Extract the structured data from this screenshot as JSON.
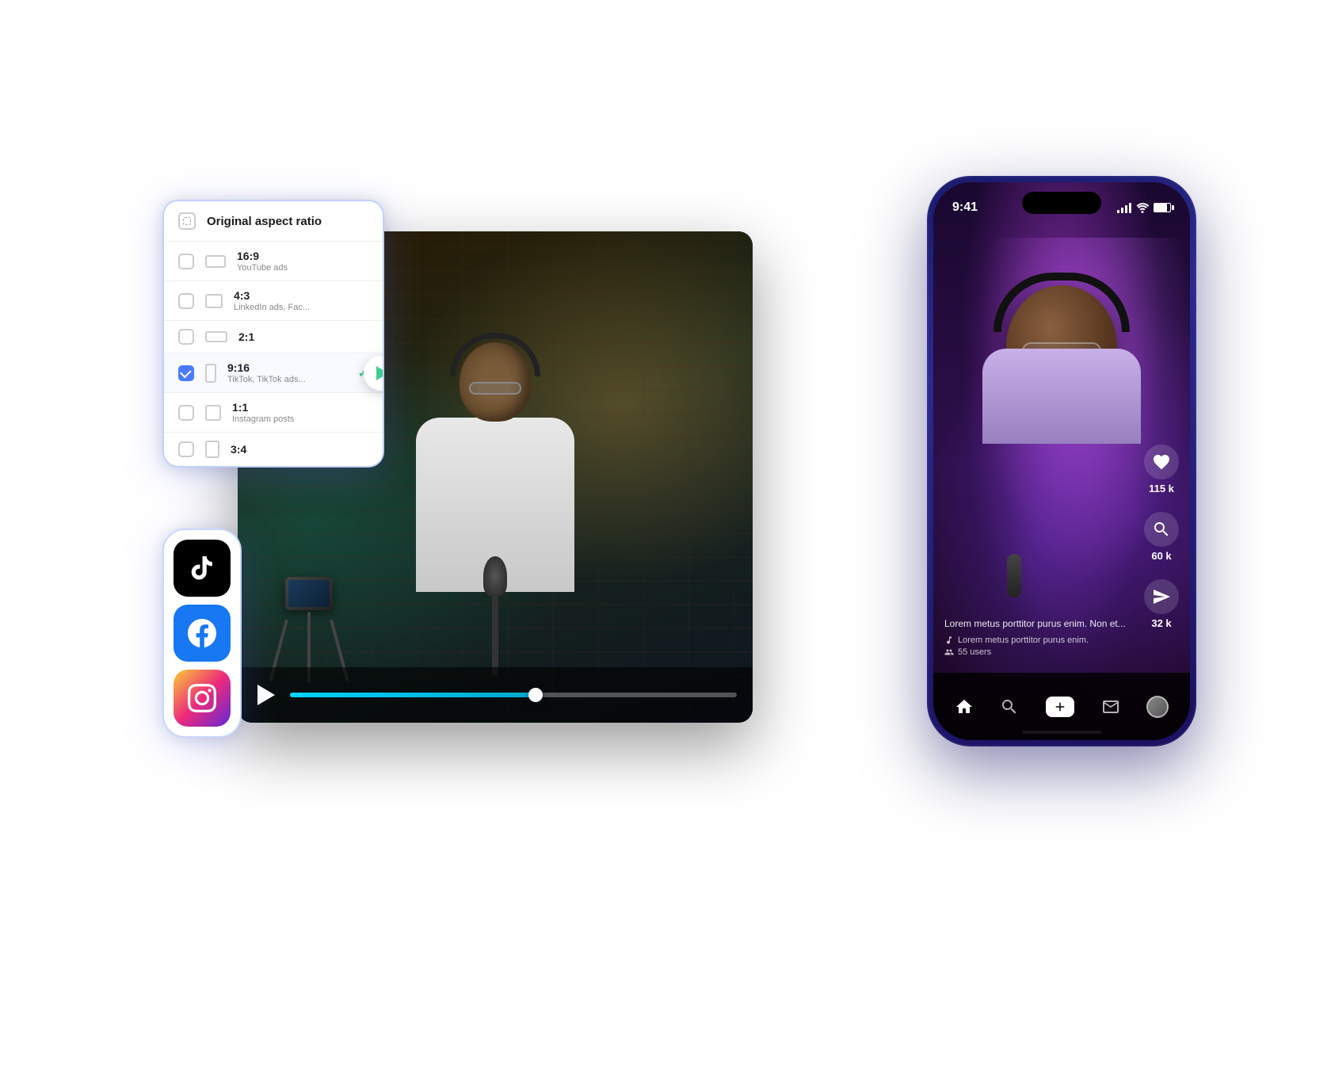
{
  "scene": {
    "background": "#ffffff"
  },
  "aspect_panel": {
    "title": "Original aspect ratio",
    "items": [
      {
        "ratio": "16:9",
        "sub": "YouTube ads",
        "selected": false
      },
      {
        "ratio": "4:3",
        "sub": "LinkedIn ads, Fac...",
        "selected": false
      },
      {
        "ratio": "2:1",
        "sub": "",
        "selected": false
      },
      {
        "ratio": "9:16",
        "sub": "TikTok, TikTok ads...",
        "selected": true,
        "active": true
      },
      {
        "ratio": "1:1",
        "sub": "Instagram posts",
        "selected": false
      },
      {
        "ratio": "3:4",
        "sub": "",
        "selected": false
      }
    ]
  },
  "video_player": {
    "playing": false,
    "progress_percent": 55
  },
  "social_icons": [
    {
      "name": "TikTok",
      "type": "tiktok"
    },
    {
      "name": "Facebook",
      "type": "facebook"
    },
    {
      "name": "Instagram",
      "type": "instagram"
    }
  ],
  "phone": {
    "status_bar": {
      "time": "9:41",
      "signal": true,
      "wifi": true,
      "battery": true
    },
    "tiktok_content": {
      "description": "Lorem metus porttitor purus enim. Non et...",
      "music": "Lorem metus porttitor purus enim.",
      "users": "55 users"
    },
    "actions": [
      {
        "icon": "heart",
        "count": "115 k"
      },
      {
        "icon": "search",
        "count": "60 k"
      },
      {
        "icon": "share",
        "count": "32 k"
      }
    ],
    "nav_items": [
      "home",
      "search",
      "add",
      "inbox",
      "profile"
    ]
  }
}
